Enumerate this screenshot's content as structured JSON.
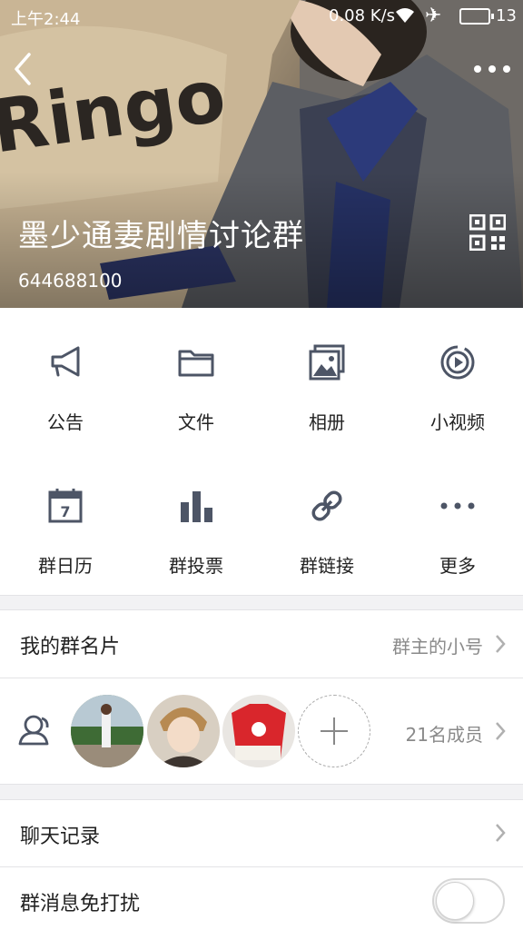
{
  "status_bar": {
    "time": "上午2:44",
    "net_speed": "0.08 K/s",
    "battery": "13"
  },
  "header": {
    "group_name": "墨少通妻剧情讨论群",
    "group_id": "644688100",
    "background_text": "Ringo"
  },
  "features": [
    {
      "label": "公告",
      "icon": "megaphone-icon"
    },
    {
      "label": "文件",
      "icon": "folder-icon"
    },
    {
      "label": "相册",
      "icon": "album-icon"
    },
    {
      "label": "小视频",
      "icon": "video-icon"
    },
    {
      "label": "群日历",
      "icon": "calendar-icon",
      "calendar_day": "7"
    },
    {
      "label": "群投票",
      "icon": "bar-chart-icon"
    },
    {
      "label": "群链接",
      "icon": "link-icon"
    },
    {
      "label": "更多",
      "icon": "more-icon"
    }
  ],
  "my_card": {
    "label": "我的群名片",
    "value": "群主的小号"
  },
  "members": {
    "count_label": "21名成员"
  },
  "chat_history": {
    "label": "聊天记录"
  },
  "mute": {
    "label": "群消息免打扰",
    "enabled": false
  },
  "colors": {
    "icon_gray": "#4d5566",
    "text_secondary": "#8a8a8a"
  }
}
